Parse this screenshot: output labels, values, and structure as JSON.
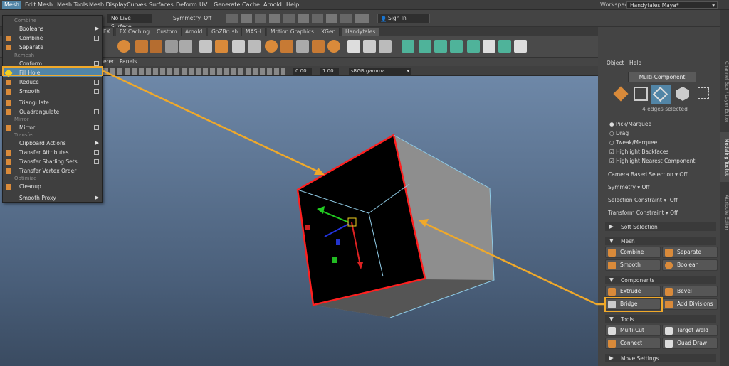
{
  "menubar": {
    "items": [
      "Mesh",
      "Edit Mesh",
      "Mesh Tools",
      "Mesh Display",
      "Curves",
      "Surfaces",
      "Deform",
      "UV",
      "Generate",
      "Cache",
      "Arnold",
      "Help"
    ],
    "workspace_label": "Workspace :",
    "workspace_value": "Handytales Maya*"
  },
  "status": {
    "live_surface": "No Live Surface",
    "symmetry": "Symmetry: Off",
    "sign_in": "Sign In"
  },
  "shelf_tabs": [
    "FX",
    "FX Caching",
    "Custom",
    "Arnold",
    "GoZBrush",
    "MASH",
    "Motion Graphics",
    "XGen",
    "Handytales"
  ],
  "panel_menu": [
    "Panels"
  ],
  "panel_menu_partial": "erer",
  "viewport_toolbar": {
    "exposure": "0.00",
    "gamma": "1.00",
    "color_space": "sRGB gamma"
  },
  "mesh_menu": {
    "sections": {
      "combine": "Combine",
      "remesh": "Remesh",
      "mirror": "Mirror",
      "transfer": "Transfer",
      "optimize": "Optimize"
    },
    "items": {
      "booleans": "Booleans",
      "combine": "Combine",
      "separate": "Separate",
      "conform": "Conform",
      "fill_hole": "Fill Hole",
      "reduce": "Reduce",
      "smooth": "Smooth",
      "triangulate": "Triangulate",
      "quadrangulate": "Quadrangulate",
      "mirror": "Mirror",
      "clipboard": "Clipboard Actions",
      "transfer_attributes": "Transfer Attributes",
      "transfer_shading": "Transfer Shading Sets",
      "transfer_vertex": "Transfer Vertex Order",
      "cleanup": "Cleanup...",
      "smooth_proxy": "Smooth Proxy"
    }
  },
  "right_panel": {
    "menu": [
      "Object",
      "Help"
    ],
    "mode": "Multi-Component",
    "selection_count": "4 edges selected",
    "radio": [
      "Pick/Marquee",
      "Drag",
      "Tweak/Marquee"
    ],
    "checks": [
      "Highlight Backfaces",
      "Highlight Nearest Component"
    ],
    "camera_based": "Camera Based Selection",
    "camera_based_val": "Off",
    "symmetry": "Symmetry",
    "symmetry_val": "Off",
    "sel_constraint": "Selection Constraint",
    "sel_constraint_val": "Off",
    "transform_constraint": "Transform Constraint",
    "transform_constraint_val": "Off",
    "frames": {
      "soft": "Soft Selection",
      "mesh": "Mesh",
      "components": "Components",
      "tools": "Tools",
      "move": "Move Settings"
    },
    "buttons": {
      "combine": "Combine",
      "separate": "Separate",
      "smooth": "Smooth",
      "boolean": "Boolean",
      "extrude": "Extrude",
      "bevel": "Bevel",
      "bridge": "Bridge",
      "add_divisions": "Add Divisions",
      "multi_cut": "Multi-Cut",
      "target_weld": "Target Weld",
      "connect": "Connect",
      "quad_draw": "Quad Draw"
    }
  },
  "side_tabs": [
    "Channel Box / Layer Editor",
    "Modeling Toolkit",
    "Attribute Editor"
  ],
  "colors": {
    "highlight": "#f0a92a",
    "menu_active": "#5285a6",
    "selected_edge": "#ff2020"
  }
}
